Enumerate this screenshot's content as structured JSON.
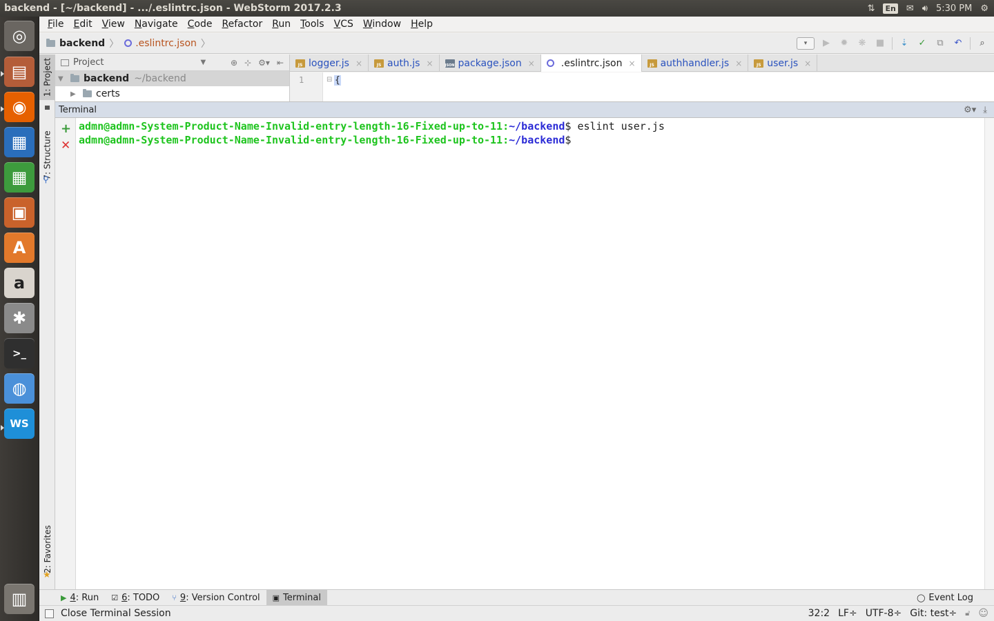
{
  "os_panel": {
    "window_title": "backend - [~/backend] - .../.eslintrc.json - WebStorm 2017.2.3",
    "lang": "En",
    "time": "5:30 PM",
    "icons": [
      "network-icon",
      "keyboard-layout-icon",
      "mail-icon",
      "volume-icon",
      "settings-gear-icon"
    ]
  },
  "launcher": {
    "items": [
      {
        "name": "ubuntu-dash",
        "icon": "ubuntu-logo-icon",
        "glyph": "◎",
        "color": "#6a6661"
      },
      {
        "name": "files",
        "icon": "files-icon",
        "glyph": "▤",
        "color": "#b45d39"
      },
      {
        "name": "firefox",
        "icon": "firefox-icon",
        "glyph": "◉",
        "color": "#e66000"
      },
      {
        "name": "libreoffice-writer",
        "icon": "writer-icon",
        "glyph": "▦",
        "color": "#2a6ebb"
      },
      {
        "name": "libreoffice-calc",
        "icon": "calc-icon",
        "glyph": "▦",
        "color": "#3d9b3d"
      },
      {
        "name": "libreoffice-impress",
        "icon": "impress-icon",
        "glyph": "▣",
        "color": "#c9622b"
      },
      {
        "name": "software-center",
        "icon": "software-center-icon",
        "glyph": "A",
        "color": "#e2792b"
      },
      {
        "name": "amazon",
        "icon": "amazon-icon",
        "glyph": "a",
        "color": "#d9d4cd"
      },
      {
        "name": "system-settings",
        "icon": "system-settings-icon",
        "glyph": "✱",
        "color": "#8a8a8a"
      },
      {
        "name": "terminal",
        "icon": "terminal-icon",
        "glyph": ">_",
        "color": "#2f2f2f"
      },
      {
        "name": "chrome",
        "icon": "chrome-icon",
        "glyph": "◍",
        "color": "#4a90d9"
      },
      {
        "name": "webstorm",
        "icon": "webstorm-icon",
        "glyph": "WS",
        "color": "#1e8fd8"
      },
      {
        "name": "trash",
        "icon": "trash-icon",
        "glyph": "▥",
        "color": "#7a7670"
      }
    ]
  },
  "menu": [
    "File",
    "Edit",
    "View",
    "Navigate",
    "Code",
    "Refactor",
    "Run",
    "Tools",
    "VCS",
    "Window",
    "Help"
  ],
  "breadcrumb": {
    "project": "backend",
    "file": ".eslintrc.json"
  },
  "left_tabs": {
    "project": "1: Project",
    "structure": "7: Structure",
    "favorites": "2: Favorites"
  },
  "project_panel": {
    "view_label": "Project",
    "tree": [
      {
        "name": "backend",
        "path": "~/backend",
        "expanded": true
      },
      {
        "name": "certs",
        "expanded": false
      }
    ]
  },
  "editor_tabs": [
    {
      "label": "logger.js",
      "type": "js",
      "active": false
    },
    {
      "label": "auth.js",
      "type": "js",
      "active": false
    },
    {
      "label": "package.json",
      "type": "json",
      "active": false
    },
    {
      "label": ".eslintrc.json",
      "type": "eslint",
      "active": true
    },
    {
      "label": "authhandler.js",
      "type": "js",
      "active": false
    },
    {
      "label": "user.js",
      "type": "js",
      "active": false
    }
  ],
  "editor": {
    "line_number": "1",
    "code": "{"
  },
  "terminal": {
    "title": "Terminal",
    "lines": [
      {
        "user": "admn@admn-System-Product-Name-Invalid-entry-length-16-Fixed-up-to-11",
        "sep": ":",
        "path": "~/backend",
        "prompt": "$",
        "command": " eslint user.js"
      },
      {
        "user": "admn@admn-System-Product-Name-Invalid-entry-length-16-Fixed-up-to-11",
        "sep": ":",
        "path": "~/backend",
        "prompt": "$",
        "command": ""
      }
    ]
  },
  "bottom_tabs": {
    "run_key": "4",
    "run": ": Run",
    "todo_key": "6",
    "todo": ": TODO",
    "vc_key": "9",
    "vc": ": Version Control",
    "terminal": "Terminal",
    "event_log": "Event Log"
  },
  "status": {
    "message": "Close Terminal Session",
    "position": "32:2",
    "line_sep": "LF÷",
    "encoding": "UTF-8÷",
    "git": "Git: test÷"
  }
}
